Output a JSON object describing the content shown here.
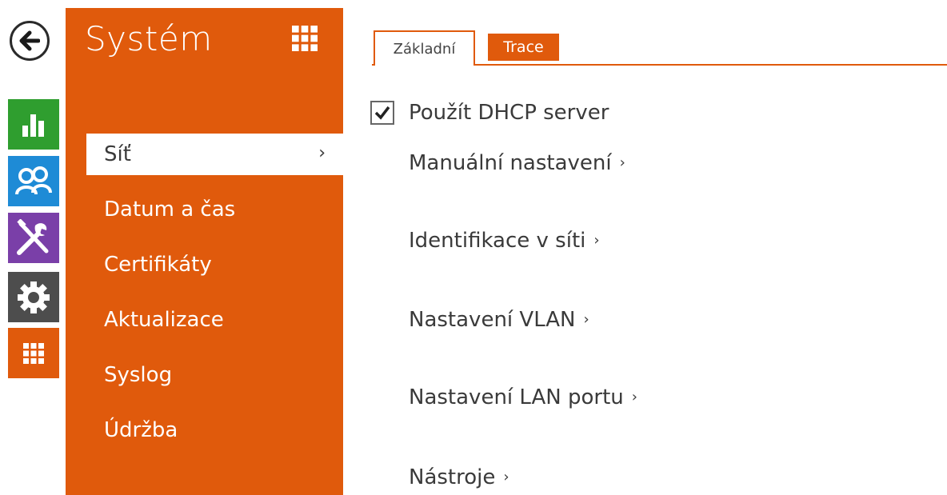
{
  "colors": {
    "accent": "#e05a0c",
    "status_green": "#2f9e2f",
    "directory_blue": "#1e8bd6",
    "hardware_purple": "#7a3fa8",
    "settings_gray": "#4d4d4d",
    "text": "#3a3a3a"
  },
  "rail": {
    "back_icon": "arrow-left-icon",
    "tiles": [
      {
        "name": "status",
        "icon": "bar-chart-icon"
      },
      {
        "name": "directory",
        "icon": "users-icon"
      },
      {
        "name": "hardware",
        "icon": "tools-icon"
      },
      {
        "name": "system",
        "icon": "gear-icon"
      },
      {
        "name": "apps",
        "icon": "grid-icon"
      }
    ]
  },
  "menu": {
    "title": "Systém",
    "items": [
      {
        "label": "Síť",
        "active": true
      },
      {
        "label": "Datum a čas"
      },
      {
        "label": "Certifikáty"
      },
      {
        "label": "Aktualizace"
      },
      {
        "label": "Syslog"
      },
      {
        "label": "Údržba"
      }
    ],
    "active_chevron": "›"
  },
  "tabs": [
    {
      "label": "Základní",
      "active": true
    },
    {
      "label": "Trace",
      "active": false
    }
  ],
  "content": {
    "dhcp_label": "Použít DHCP server",
    "dhcp_checked": true,
    "sections": [
      {
        "label": "Manuální nastavení",
        "arrow": "›"
      },
      {
        "label": "Identifikace v síti",
        "arrow": "›"
      },
      {
        "label": "Nastavení VLAN",
        "arrow": "›"
      },
      {
        "label": "Nastavení LAN portu",
        "arrow": "›"
      },
      {
        "label": "Nástroje",
        "arrow": "›"
      }
    ]
  }
}
